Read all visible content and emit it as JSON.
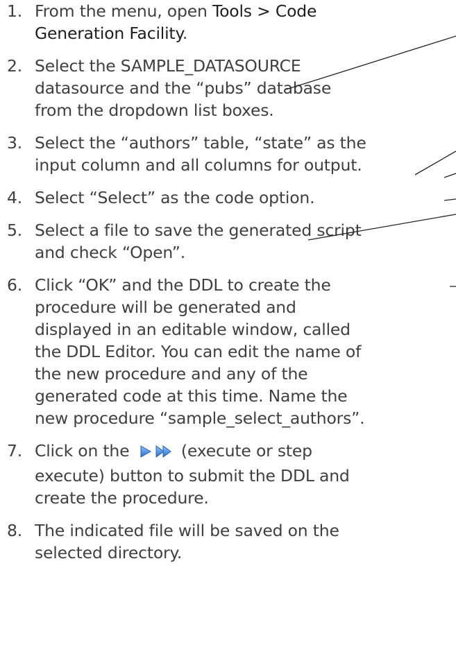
{
  "steps": [
    {
      "num": "1.",
      "lines": [
        "From the menu, open ",
        "Tools > Code",
        "Generation Facility",
        "."
      ]
    },
    {
      "num": "2.",
      "lines": [
        "Select the SAMPLE_DATASOURCE",
        "datasource and the “pubs” database",
        "from the dropdown list boxes."
      ]
    },
    {
      "num": "3.",
      "lines": [
        "Select the “authors” table, “state” as the",
        "input column and all columns for output."
      ]
    },
    {
      "num": "4.",
      "lines": [
        "Select “Select” as the code option."
      ]
    },
    {
      "num": "5.",
      "lines": [
        "Select a file to save the generated script",
        "and check “Open”."
      ]
    },
    {
      "num": "6.",
      "lines": [
        "Click “OK” and the DDL to create the",
        "procedure will be generated and",
        "displayed in an editable window, called",
        "the DDL Editor.  You can edit the name of",
        "the new procedure and any of the",
        "generated code at this time.  Name the",
        "new procedure “sample_select_authors”."
      ]
    },
    {
      "num": "7.",
      "lines": [
        "Click on the ",
        " (execute or step",
        "execute) button to submit the DDL and",
        "create the procedure."
      ]
    },
    {
      "num": "8.",
      "lines": [
        "The indicated file will be saved on the",
        "selected directory."
      ]
    }
  ],
  "icons": {
    "execute": "execute-icon",
    "step_execute": "step-execute-icon",
    "color": "#3a7bd5"
  }
}
